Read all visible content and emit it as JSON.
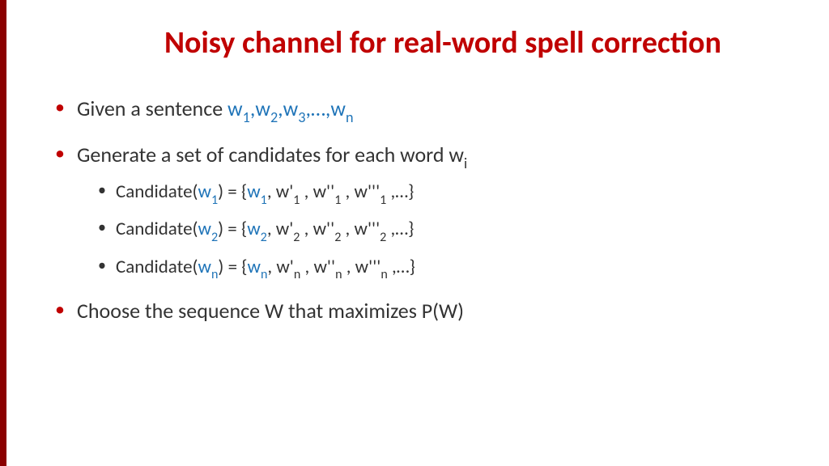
{
  "title": "Noisy channel for real-word spell correction",
  "bullets": {
    "b1_prefix": "Given a sentence ",
    "b1_w": "w",
    "b1_comma": ",",
    "b1_ellipsis": ",…,",
    "b2_text": "Generate a set of candidates for each word w",
    "b2_sub": "i",
    "sub1_prefix": "Candidate(",
    "sub1_eq": ") = {",
    "sub1_items": ", w'",
    "sub1_items2": " , w''",
    "sub1_items3": " , w'''",
    "sub1_end": " ,…}",
    "b3_text": "Choose the sequence W that maximizes P(W)"
  },
  "subs": {
    "s1": "1",
    "s2": "2",
    "s3": "3",
    "sn": "n"
  }
}
